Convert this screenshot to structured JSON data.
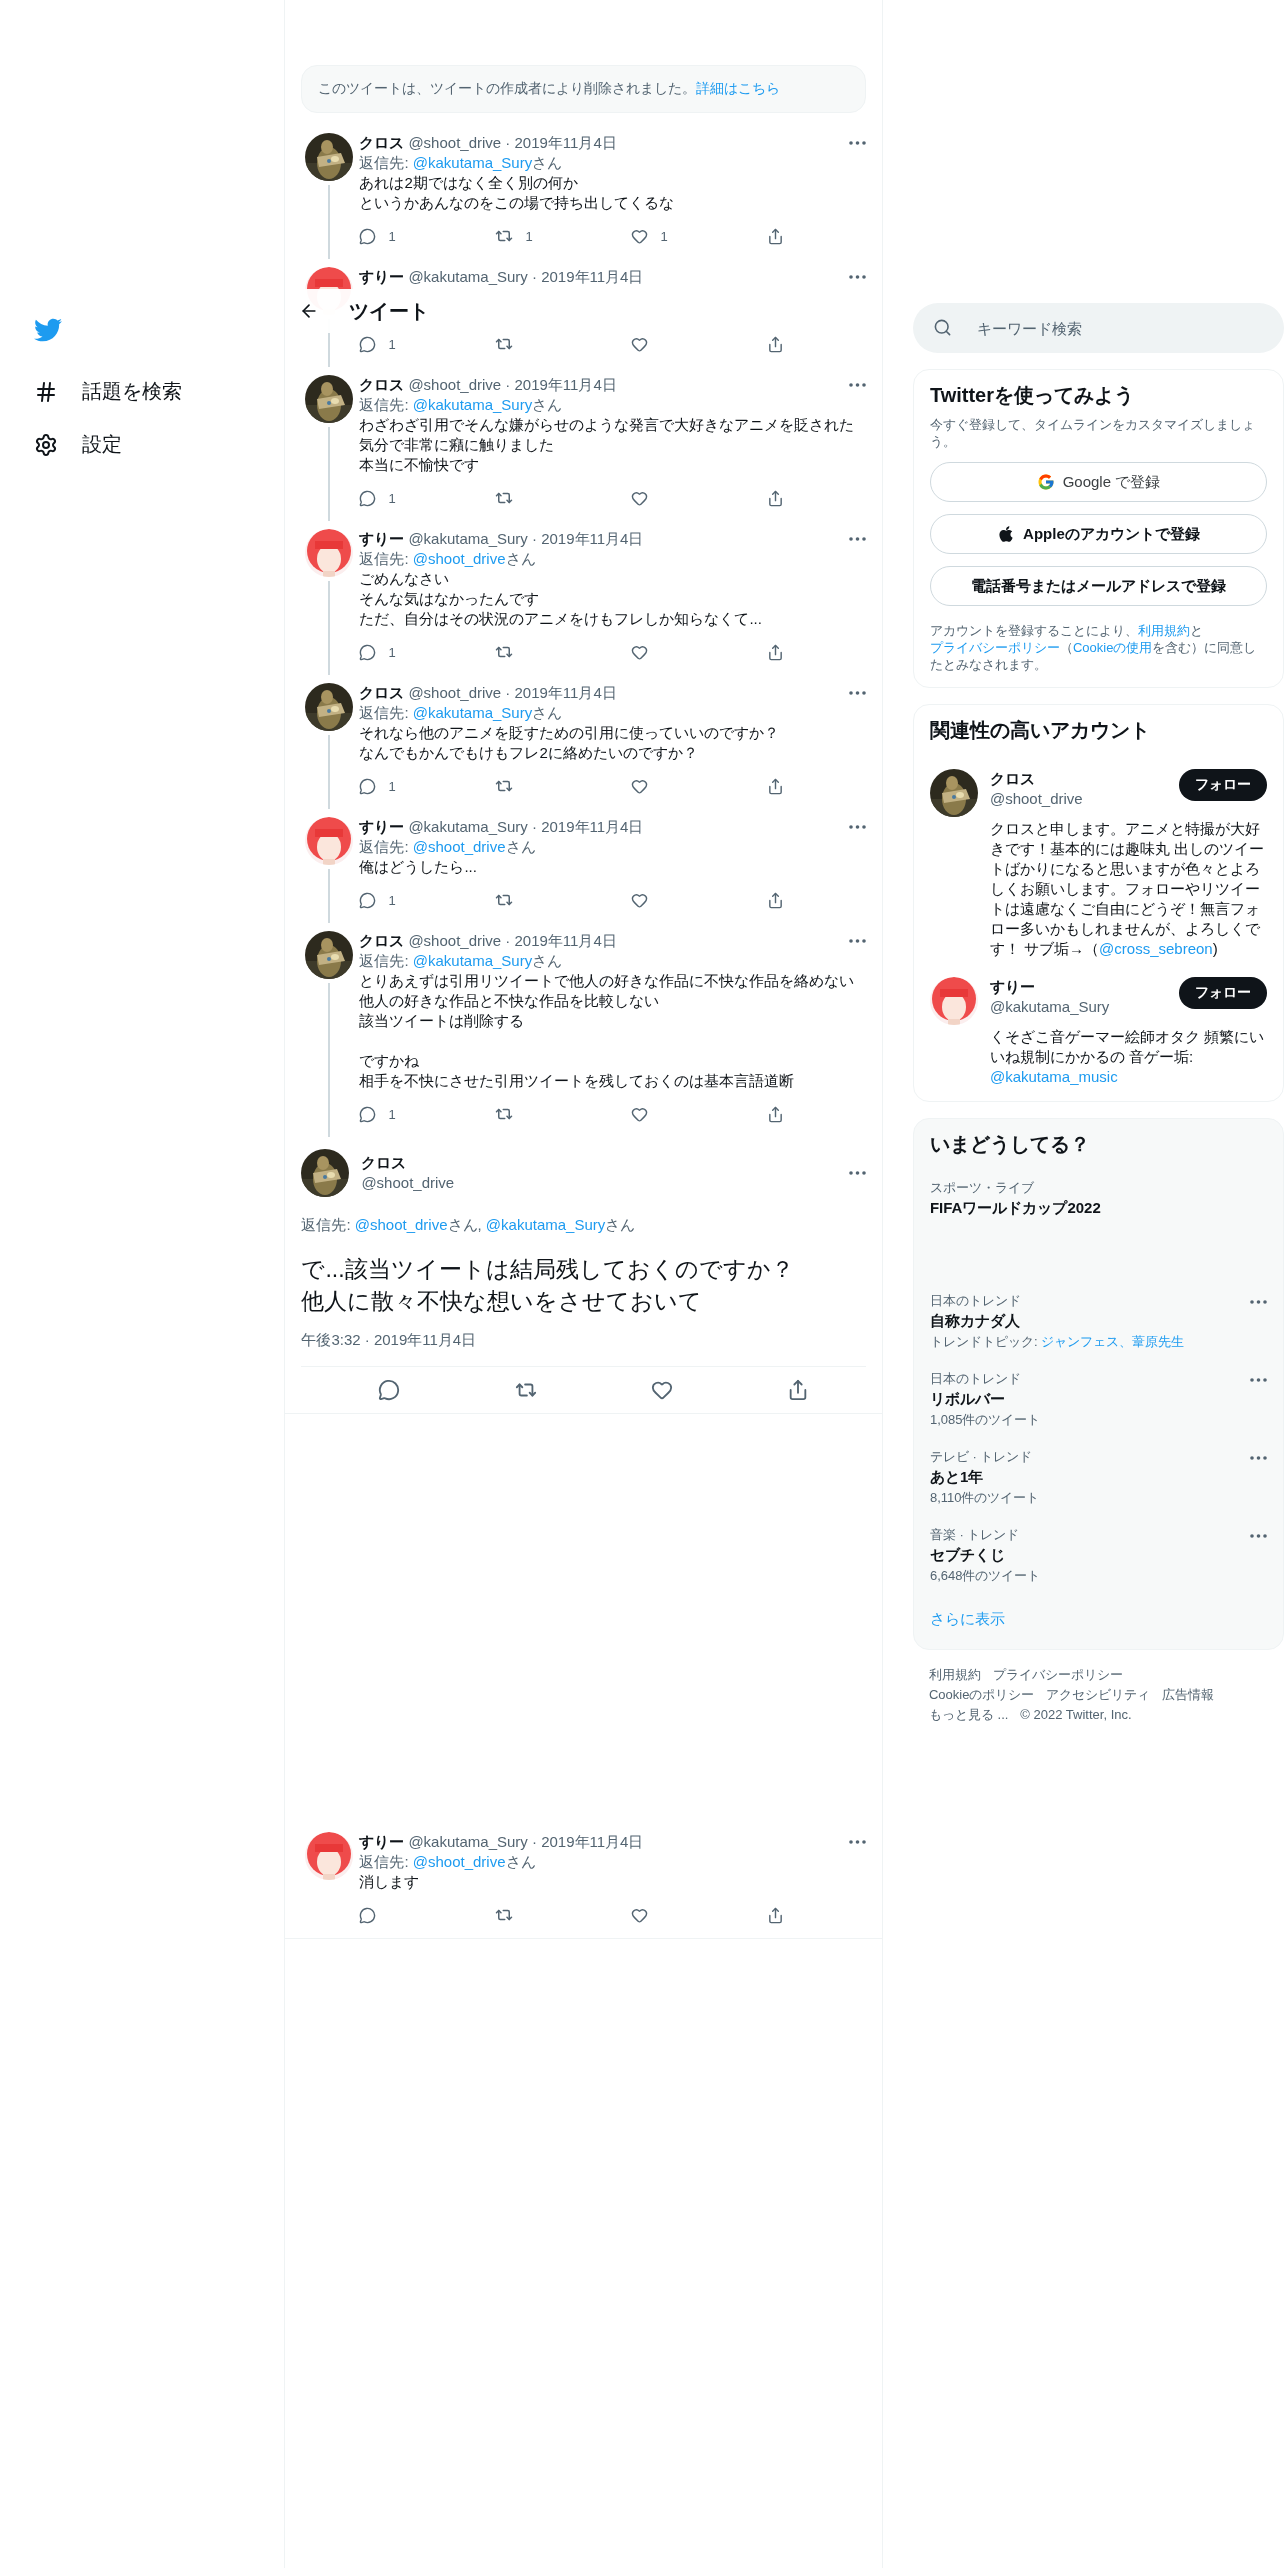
{
  "sidebar": {
    "items": [
      {
        "kind": "explore",
        "label": "話題を検索"
      },
      {
        "kind": "settings",
        "label": "設定"
      }
    ]
  },
  "header": {
    "title": "ツイート"
  },
  "deleted_notice": {
    "text": "このツイートは、ツイートの作成者により削除されました。",
    "link": "詳細はこちら"
  },
  "thread": [
    {
      "kind": "figure",
      "author": "クロス",
      "meta": "@shoot_drive · 2019年11月4日",
      "covered": false,
      "reply_label": "返信先:",
      "mentions": [
        {
          "handle": "@kakutama_Sury",
          "suffix": "さん"
        }
      ],
      "paragraphs": [
        [
          "あれは2期ではなく全く別の何か",
          "というかあんなのをこの場で持ち出してくるな"
        ]
      ],
      "replies": "1",
      "retweets": "1",
      "likes": "1"
    },
    {
      "kind": "redhair",
      "author": "すりー",
      "meta": "@kakutama_Sury · 2019年11月4日",
      "covered": true,
      "replies": "1"
    },
    {
      "kind": "figure",
      "author": "クロス",
      "meta": "@shoot_drive · 2019年11月4日",
      "covered": false,
      "reply_label": "返信先:",
      "mentions": [
        {
          "handle": "@kakutama_Sury",
          "suffix": "さん"
        }
      ],
      "paragraphs": [
        [
          "わざわざ引用でそんな嫌がらせのような発言で大好きなアニメを貶された",
          "気分で非常に癪に触りました",
          "本当に不愉快です"
        ]
      ],
      "replies": "1"
    },
    {
      "kind": "redhair",
      "author": "すりー",
      "meta": "@kakutama_Sury · 2019年11月4日",
      "covered": false,
      "reply_label": "返信先:",
      "mentions": [
        {
          "handle": "@shoot_drive",
          "suffix": "さん"
        }
      ],
      "paragraphs": [
        [
          "ごめんなさい",
          "そんな気はなかったんです",
          "ただ、自分はその状況のアニメをけもフレしか知らなくて..."
        ]
      ],
      "replies": "1"
    },
    {
      "kind": "figure",
      "author": "クロス",
      "meta": "@shoot_drive · 2019年11月4日",
      "covered": false,
      "reply_label": "返信先:",
      "mentions": [
        {
          "handle": "@kakutama_Sury",
          "suffix": "さん"
        }
      ],
      "paragraphs": [
        [
          "それなら他のアニメを貶すための引用に使っていいのですか？",
          "なんでもかんでもけもフレ2に絡めたいのですか？"
        ]
      ],
      "replies": "1"
    },
    {
      "kind": "redhair",
      "author": "すりー",
      "meta": "@kakutama_Sury · 2019年11月4日",
      "covered": false,
      "reply_label": "返信先:",
      "mentions": [
        {
          "handle": "@shoot_drive",
          "suffix": "さん"
        }
      ],
      "paragraphs": [
        [
          "俺はどうしたら..."
        ]
      ],
      "replies": "1"
    },
    {
      "kind": "figure",
      "author": "クロス",
      "meta": "@shoot_drive · 2019年11月4日",
      "covered": false,
      "reply_label": "返信先:",
      "mentions": [
        {
          "handle": "@kakutama_Sury",
          "suffix": "さん"
        }
      ],
      "paragraphs": [
        [
          "とりあえずは引用リツイートで他人の好きな作品に不快な作品を絡めない",
          "他人の好きな作品と不快な作品を比較しない",
          "該当ツイートは削除する"
        ],
        [
          "ですかね",
          "相手を不快にさせた引用ツイートを残しておくのは基本言語道断"
        ]
      ],
      "replies": "1"
    }
  ],
  "main_tweet": {
    "kind": "figure",
    "author": "クロス",
    "handle": "@shoot_drive",
    "reply_label": "返信先:",
    "mentions": [
      {
        "handle": "@shoot_drive",
        "suffix": "さん,"
      },
      {
        "handle": "@kakutama_Sury",
        "suffix": "さん"
      }
    ],
    "lines": [
      "で...該当ツイートは結局残しておくのですか？",
      "他人に散々不快な想いをさせておいて"
    ],
    "time": "午後3:32 · 2019年11月4日"
  },
  "replies": [
    {
      "kind": "redhair",
      "author": "すりー",
      "meta": "@kakutama_Sury · 2019年11月4日",
      "covered": false,
      "reply_label": "返信先:",
      "mentions": [
        {
          "handle": "@shoot_drive",
          "suffix": "さん"
        }
      ],
      "paragraphs": [
        [
          "消します"
        ]
      ]
    }
  ],
  "search": {
    "placeholder": "キーワード検索"
  },
  "signup": {
    "title": "Twitterを使ってみよう",
    "subtitle": "今すぐ登録して、タイムラインをカスタマイズしましょう。",
    "buttons": [
      {
        "kind": "google",
        "label": "Google で登録"
      },
      {
        "kind": "apple",
        "label": "Appleのアカウントで登録"
      },
      {
        "kind": "phone",
        "label": "電話番号またはメールアドレスで登録"
      }
    ],
    "legal": [
      {
        "text": "アカウントを登録することにより、",
        "link": false
      },
      {
        "text": "利用規約",
        "link": true
      },
      {
        "text": "と",
        "link": false
      },
      {
        "text": "プライバシーポリシー",
        "link": true
      },
      {
        "text": "（",
        "link": false
      },
      {
        "text": "Cookieの使用",
        "link": true
      },
      {
        "text": "を含む）に同意したとみなされます。",
        "link": false
      }
    ]
  },
  "related": {
    "title": "関連性の高いアカウント",
    "accounts": [
      {
        "kind": "figure",
        "name": "クロス",
        "handle": "@shoot_drive",
        "follow": "フォロー",
        "bio": [
          {
            "text": "クロスと申します。アニメと特撮が大好きです！基本的には趣味丸 出しのツイートばかりになると思いますが色々とよろしくお願いします。フォローやリツイートは遠慮なくご自由にどうぞ！無言フォロー多いかもしれませんが、よろしくです！ サブ垢→（",
            "link": false
          },
          {
            "text": "@cross_sebreon",
            "link": true
          },
          {
            "text": ")",
            "link": false
          }
        ]
      },
      {
        "kind": "redhair",
        "name": "すりー",
        "handle": "@kakutama_Sury",
        "follow": "フォロー",
        "bio": [
          {
            "text": "くそざこ音ゲーマー絵師オタク 頻繁にいいね規制にかかるの 音ゲー垢: ",
            "link": false
          },
          {
            "text": "@kakutama_music",
            "link": true
          }
        ]
      }
    ]
  },
  "trends": {
    "title": "いまどうしてる？",
    "items": [
      {
        "kind": "live",
        "context": "スポーツ・ライブ",
        "name": "FIFAワールドカップ2022"
      },
      {
        "kind": "trend",
        "context": "日本のトレンド",
        "name": "自称カナダ人",
        "topics_label": "トレンドトピック:",
        "topics": "ジャンフェス、葦原先生"
      },
      {
        "kind": "trend",
        "context": "日本のトレンド",
        "name": "リボルバー",
        "count": "1,085件のツイート"
      },
      {
        "kind": "trend",
        "context": "テレビ · トレンド",
        "name": "あと1年",
        "count": "8,110件のツイート"
      },
      {
        "kind": "trend",
        "context": "音楽 · トレンド",
        "name": "セブチくじ",
        "count": "6,648件のツイート"
      }
    ],
    "more": "さらに表示"
  },
  "footer": [
    [
      "利用規約",
      "プライバシーポリシー"
    ],
    [
      "Cookieのポリシー",
      "アクセシビリティ",
      "広告情報"
    ],
    [
      "もっと見る ...",
      "© 2022 Twitter, Inc."
    ]
  ]
}
